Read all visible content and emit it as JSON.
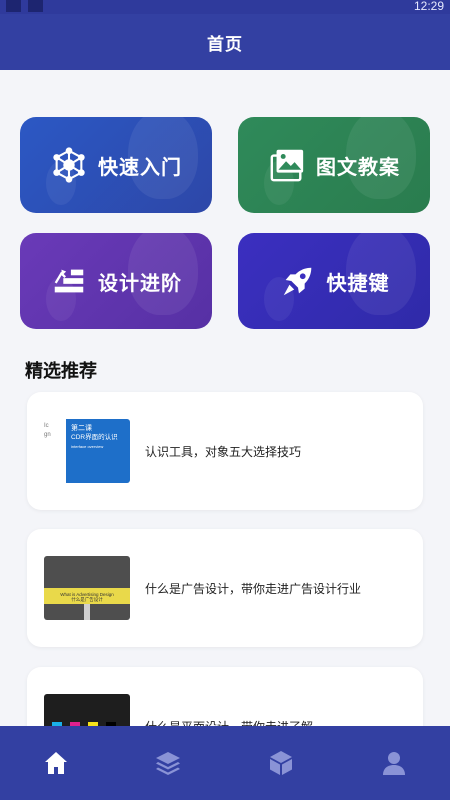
{
  "status_bar": {
    "time": "12:29"
  },
  "header": {
    "title": "首页"
  },
  "tiles": [
    {
      "label": "快速入门",
      "icon": "hub-icon"
    },
    {
      "label": "图文教案",
      "icon": "image-gallery-icon"
    },
    {
      "label": "设计进阶",
      "icon": "steps-icon"
    },
    {
      "label": "快捷键",
      "icon": "rocket-icon"
    }
  ],
  "section": {
    "title": "精选推荐"
  },
  "cards": [
    {
      "title": "认识工具，对象五大选择技巧",
      "thumb": {
        "lines": [
          "第二课",
          "CDR界面的认识",
          "interface overview"
        ],
        "side_text": [
          "Ic",
          "gn"
        ]
      }
    },
    {
      "title": "什么是广告设计，带你走进广告设计行业",
      "thumb": {
        "lines": [
          "What is Advertising Design",
          "什么是广告设计"
        ]
      }
    },
    {
      "title": "什么是平面设计，带你走进了解",
      "thumb": {
        "swatches": [
          "#1ab0e8",
          "#e0208e",
          "#f5e21a",
          "#000000"
        ]
      }
    }
  ],
  "tabbar": {
    "items": [
      {
        "icon": "home-icon",
        "active": true
      },
      {
        "icon": "layers-icon",
        "active": false
      },
      {
        "icon": "cube-icon",
        "active": false
      },
      {
        "icon": "user-icon",
        "active": false
      }
    ]
  },
  "colors": {
    "header": "#3340a2",
    "tab_active": "#ffffff",
    "tab_inactive": "#8a93d6"
  }
}
